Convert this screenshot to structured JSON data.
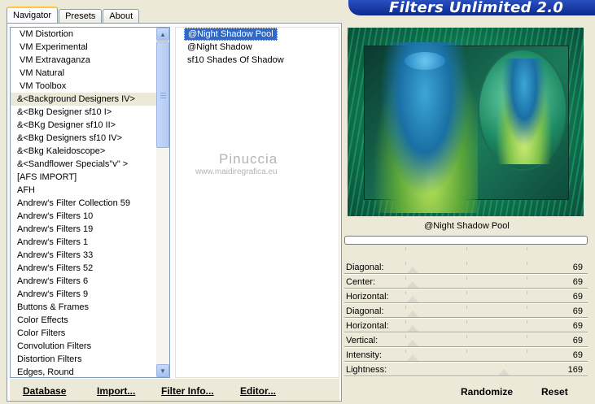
{
  "tabs": [
    "Navigator",
    "Presets",
    "About"
  ],
  "banner": "Filters Unlimited 2.0",
  "categories": [
    "VM Distortion",
    "VM Experimental",
    "VM Extravaganza",
    "VM Natural",
    "VM Toolbox",
    "&<Background Designers IV>",
    "&<Bkg Designer sf10 I>",
    "&<BKg Designer sf10 II>",
    "&<Bkg Designers sf10 IV>",
    "&<Bkg Kaleidoscope>",
    "&<Sandflower Specials\"v\" >",
    "[AFS IMPORT]",
    "AFH",
    "Andrew's Filter Collection 59",
    "Andrew's Filters 10",
    "Andrew's Filters 19",
    "Andrew's Filters 1",
    "Andrew's Filters 33",
    "Andrew's Filters 52",
    "Andrew's Filters 6",
    "Andrew's Filters 9",
    "Buttons & Frames",
    "Color Effects",
    "Color Filters",
    "Convolution Filters",
    "Distortion Filters",
    "Edges, Round"
  ],
  "selected_category_index": 5,
  "filters": [
    "@Night Shadow Pool",
    "@Night Shadow",
    "sf10 Shades Of Shadow"
  ],
  "selected_filter_index": 0,
  "watermark": {
    "name": "Pinuccia",
    "url": "www.maidiregrafica.eu"
  },
  "bottom_buttons": [
    "Database",
    "Import...",
    "Filter Info...",
    "Editor..."
  ],
  "filter_title": "@Night Shadow Pool",
  "sliders": [
    {
      "label": "Diagonal:",
      "value": 69
    },
    {
      "label": "Center:",
      "value": 69
    },
    {
      "label": "Horizontal:",
      "value": 69
    },
    {
      "label": "Diagonal:",
      "value": 69
    },
    {
      "label": "Horizontal:",
      "value": 69
    },
    {
      "label": "Vertical:",
      "value": 69
    },
    {
      "label": "Intensity:",
      "value": 69
    },
    {
      "label": "Lightness:",
      "value": 169
    }
  ],
  "slider_max": 255,
  "right_buttons": {
    "randomize": "Randomize",
    "reset": "Reset"
  },
  "colors": {
    "banner": "#0a2a8c",
    "selection": "#316ac5",
    "face": "#ece9d8"
  }
}
